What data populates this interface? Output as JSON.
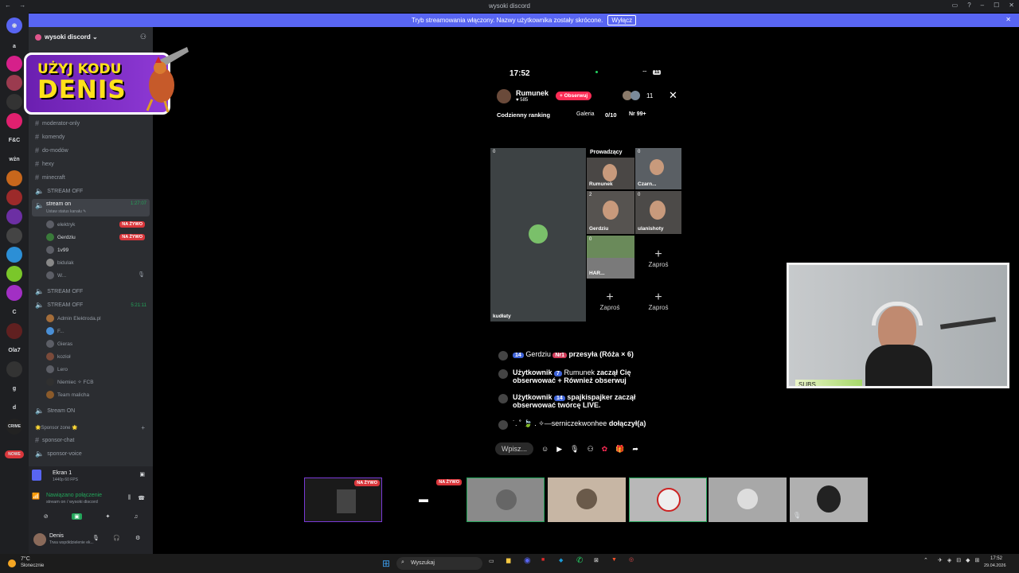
{
  "window": {
    "title": "wysoki discord",
    "nav_arrows": "← →"
  },
  "banner": {
    "text": "Tryb streamowania włączony. Nazwy użytkownika zostały skrócone.",
    "button": "Wyłącz",
    "close": "✕"
  },
  "rail": {
    "letters": [
      "a",
      "F&C",
      "wżn",
      "C",
      "Ola7",
      "g",
      "d"
    ],
    "crime": "CRIME",
    "nowe": "NOWE"
  },
  "server": {
    "name": "wysoki discord ⌄"
  },
  "promo": {
    "line1": "UŻYJ KODU",
    "line2": "DENIS"
  },
  "channels": [
    {
      "name": "moderator-only"
    },
    {
      "name": "komendy"
    },
    {
      "name": "do-modów"
    },
    {
      "name": "hexy"
    },
    {
      "name": "minecraft"
    }
  ],
  "voice": {
    "stream_off_1": "STREAM OFF",
    "stream_on": {
      "name": "stream on",
      "time": "1:27:07",
      "status": "Ustaw status kanału ✎"
    },
    "users": [
      {
        "name": "elektryk",
        "live": "NA ŻYWO"
      },
      {
        "name": "Gerdziu",
        "live": "NA ŻYWO"
      },
      {
        "name": "1v99",
        "live": ""
      },
      {
        "name": "bidulak",
        "live": ""
      },
      {
        "name": "W...",
        "live": ""
      }
    ],
    "stream_off_2": "STREAM OFF",
    "stream_off_3": {
      "name": "STREAM OFF",
      "time": "5:21:11"
    },
    "users2": [
      {
        "name": "Admin Elektroda.pl"
      },
      {
        "name": "F..."
      },
      {
        "name": "Gieras"
      },
      {
        "name": "kozioł"
      },
      {
        "name": "Lero"
      },
      {
        "name": "Niemiec ✧ FCB"
      },
      {
        "name": "Team malicha"
      }
    ],
    "stream_on_ch": "Stream ON",
    "sponsor_zone": "🌟Sponsor zone 🌟",
    "sponsor_chat": "sponsor-chat",
    "sponsor_voice": "sponsor-voice"
  },
  "panel": {
    "screen_title": "Ekran 1",
    "screen_sub": "1440p 60 FPS",
    "connection": "Nawiązano połączenie",
    "connection_sub": "stream on / wysoki discord",
    "user_name": "Denis",
    "user_status": "Trwa współdzielenie ek..."
  },
  "phone": {
    "time": "17:52",
    "battery": "11",
    "host_name": "Rumunek",
    "host_likes": "♥ 585",
    "follow": "+ Obserwuj",
    "viewers": "11",
    "ranking": "Codzienny ranking",
    "gallery": "Galeria",
    "gallery_count": "0/10",
    "rank": "Nr 99+",
    "main_tile": {
      "name": "kudłaty",
      "count": "0"
    },
    "host_label": "Prowadzący",
    "tiles": [
      {
        "name": "Rumunek",
        "count": ""
      },
      {
        "name": "Czarn...",
        "count": "0"
      },
      {
        "name": "Gerdziu",
        "count": "2"
      },
      {
        "name": "ulanishoty",
        "count": "0"
      },
      {
        "name": "HAR...",
        "count": "0"
      }
    ],
    "invite": "Zaproś",
    "chat": [
      {
        "badge": "14",
        "user": "Gerdziu",
        "badge2": "Nr1",
        "text": "przesyła (Róża × 6)"
      },
      {
        "prefix": "Użytkownik",
        "badge": "7",
        "user": "Rumunek",
        "text": "zaczął Cię obserwować",
        "extra": "+ Również obserwuj"
      },
      {
        "prefix": "Użytkownik",
        "badge": "14",
        "user": "spajkispajker",
        "text": "zaczął obserwować twórcę LIVE."
      },
      {
        "user": "˙. ˚ 🍃 . ✧—serniczekwonhee",
        "text": "dołączył(a)"
      }
    ],
    "input_placeholder": "Wpisz..."
  },
  "webcam": {
    "label": "SUBS"
  },
  "thumbs": {
    "live": "NA ŻYWO"
  },
  "taskbar": {
    "weather_temp": "7°C",
    "weather_desc": "Słonecznie",
    "search": "Wyszukaj",
    "time": "17:52",
    "date": "29.04.2026"
  }
}
